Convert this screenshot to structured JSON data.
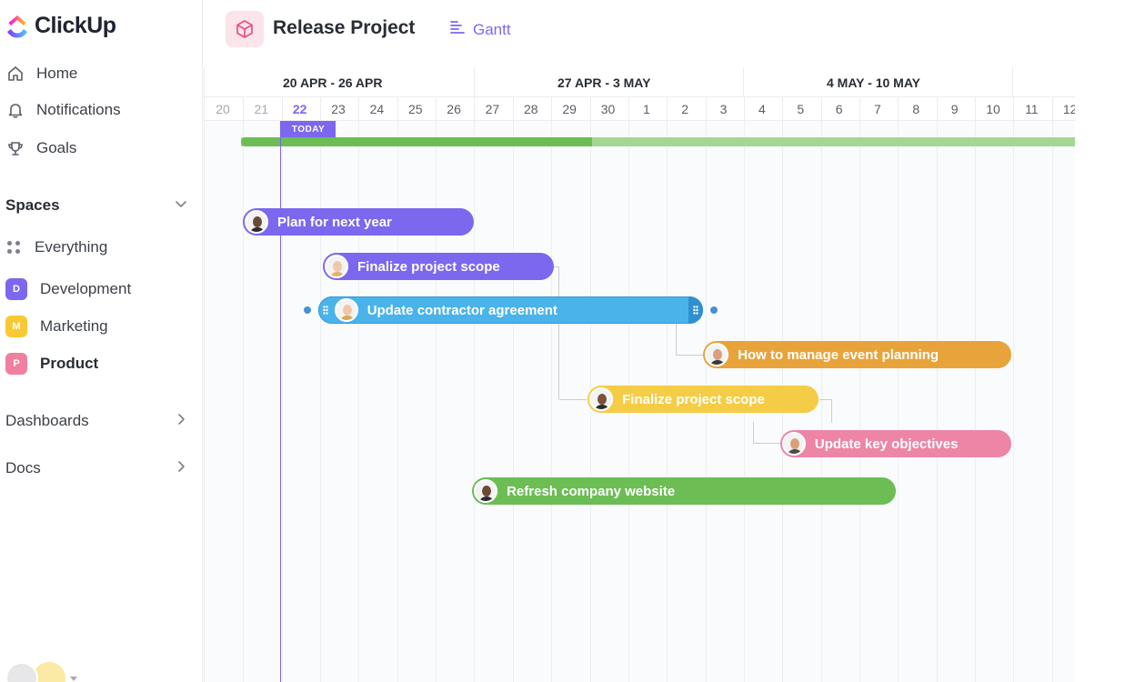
{
  "app": {
    "name": "ClickUp",
    "accent": "#7b68ee"
  },
  "sidebar": {
    "nav": [
      {
        "label": "Home",
        "icon": "home-icon"
      },
      {
        "label": "Notifications",
        "icon": "bell-icon"
      },
      {
        "label": "Goals",
        "icon": "trophy-icon"
      }
    ],
    "spaces_heading": "Spaces",
    "spaces": [
      {
        "label": "Everything",
        "badge": "",
        "icon": "grid-icon"
      },
      {
        "label": "Development",
        "badge": "D",
        "color": "#7b68ee"
      },
      {
        "label": "Marketing",
        "badge": "M",
        "color": "#f8c933"
      },
      {
        "label": "Product",
        "badge": "P",
        "color": "#f07fa0",
        "active": true
      }
    ],
    "sections": [
      {
        "label": "Dashboards"
      },
      {
        "label": "Docs"
      }
    ]
  },
  "header": {
    "project_title": "Release Project",
    "view_label": "Gantt"
  },
  "gantt": {
    "weeks": [
      "20 APR - 26 APR",
      "27 APR - 3 MAY",
      "4 MAY - 10 MAY"
    ],
    "days": [
      "20",
      "21",
      "22",
      "23",
      "24",
      "25",
      "26",
      "27",
      "28",
      "29",
      "30",
      "1",
      "2",
      "3",
      "4",
      "5",
      "6",
      "7",
      "8",
      "9",
      "10",
      "11",
      "12"
    ],
    "today_day": "22",
    "today_label": "TODAY",
    "progress": 0.42,
    "tasks": [
      {
        "label": "Plan for next year",
        "color": "#7b68ee",
        "start": 0,
        "end": 6
      },
      {
        "label": "Finalize project scope",
        "color": "#7b68ee",
        "start": 2,
        "end": 8
      },
      {
        "label": "Update contractor agreement",
        "color": "#49b3ea",
        "start": 2,
        "end": 12
      },
      {
        "label": "How to manage event planning",
        "color": "#e8a43a",
        "start": 12,
        "end": 20
      },
      {
        "label": "Finalize project scope",
        "color": "#f5cc45",
        "start": 9,
        "end": 15
      },
      {
        "label": "Update key objectives",
        "color": "#ec85a6",
        "start": 14,
        "end": 20
      },
      {
        "label": "Refresh company website",
        "color": "#6bbd54",
        "start": 6,
        "end": 17
      }
    ]
  }
}
